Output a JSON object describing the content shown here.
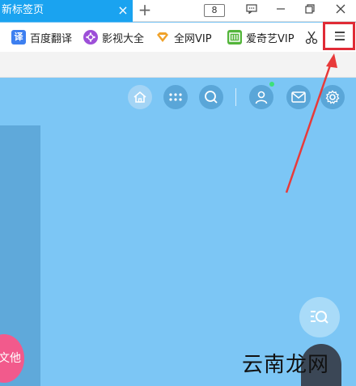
{
  "tabbar": {
    "active_tab": "新标签页",
    "close_glyph": "×",
    "new_tab_glyph": "+",
    "tab_count": "8",
    "window_controls": [
      "chat-icon",
      "minimize-icon",
      "restore-icon",
      "close-icon"
    ]
  },
  "bookmarks": [
    {
      "label": "百度翻译",
      "icon": "translate-icon",
      "icon_text": "译",
      "color": "#3d7ff0"
    },
    {
      "label": "影视大全",
      "icon": "film-icon",
      "icon_text": "",
      "color": "#9d4fd8"
    },
    {
      "label": "全网VIP",
      "icon": "vip-icon",
      "icon_text": "",
      "color": "#f0a22a"
    },
    {
      "label": "爱奇艺VIP",
      "icon": "iqiyi-icon",
      "icon_text": "",
      "color": "#53b53a"
    }
  ],
  "toolbar": {
    "scissors_icon": "scissors-icon",
    "menu_icon": "menu-icon"
  },
  "content_icons": [
    "home-icon",
    "apps-icon",
    "search-icon",
    "user-icon",
    "mail-icon",
    "settings-icon"
  ],
  "floating": {
    "pink_text": "文他",
    "watermark": "云南龙网"
  },
  "colors": {
    "accent": "#1aa3f0",
    "background": "#7cc6f5",
    "highlight": "#e02b36"
  }
}
